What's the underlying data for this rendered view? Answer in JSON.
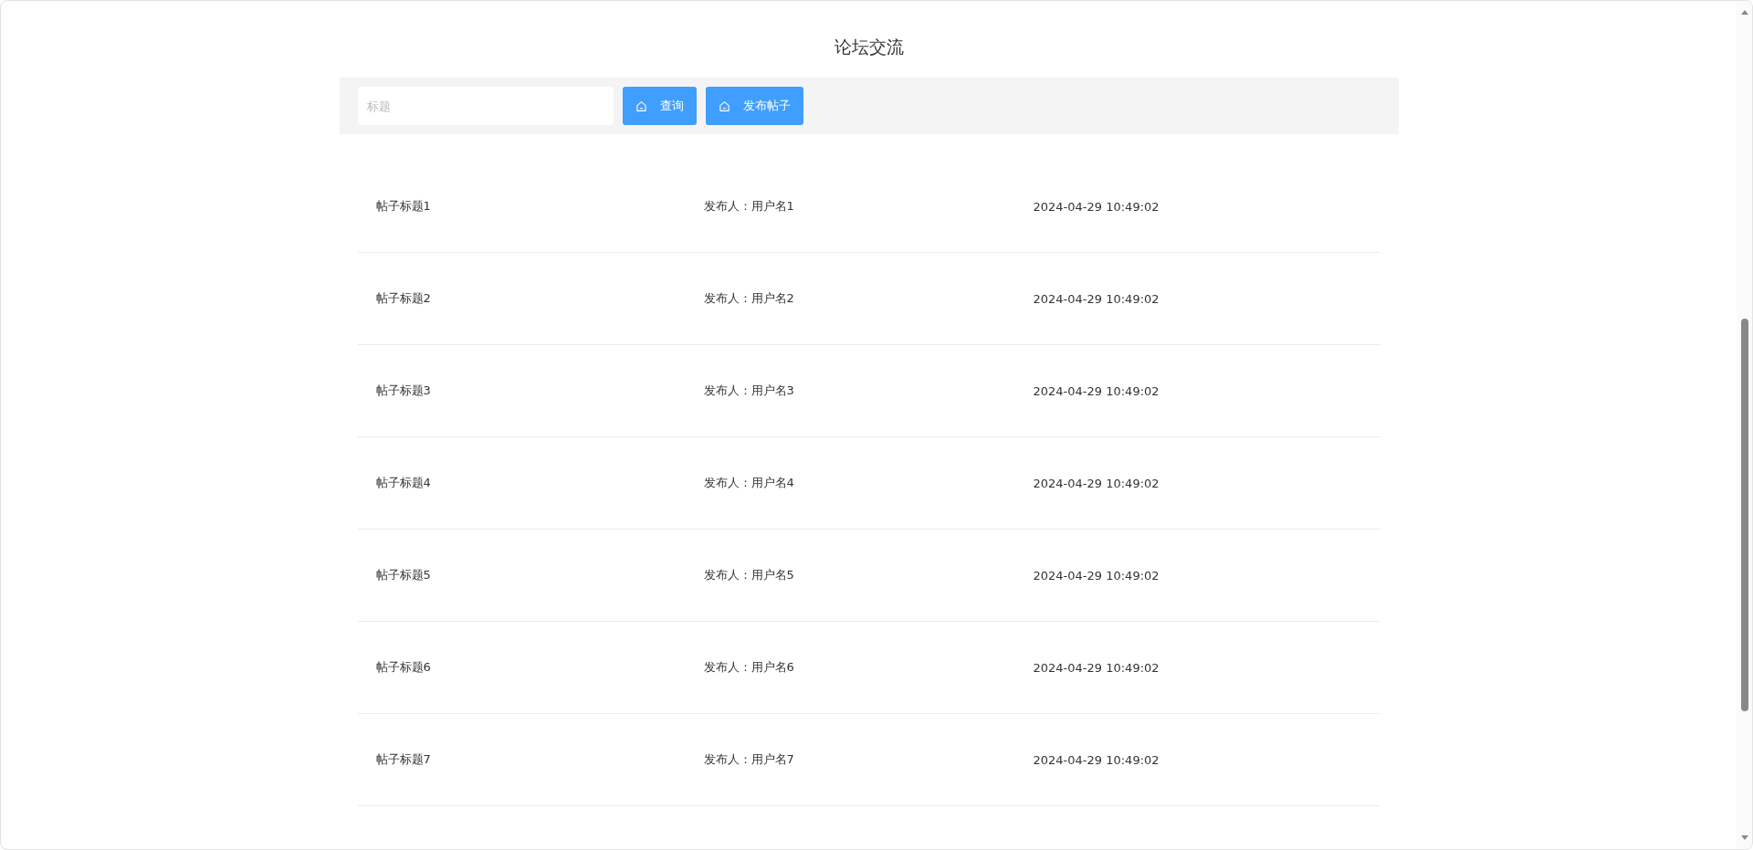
{
  "page_title": "论坛交流",
  "search": {
    "placeholder": "标题"
  },
  "buttons": [
    {
      "label": "查询"
    },
    {
      "label": "发布帖子"
    }
  ],
  "posts": [
    {
      "title": "帖子标题1",
      "author": "发布人：用户名1",
      "time": "2024-04-29 10:49:02"
    },
    {
      "title": "帖子标题2",
      "author": "发布人：用户名2",
      "time": "2024-04-29 10:49:02"
    },
    {
      "title": "帖子标题3",
      "author": "发布人：用户名3",
      "time": "2024-04-29 10:49:02"
    },
    {
      "title": "帖子标题4",
      "author": "发布人：用户名4",
      "time": "2024-04-29 10:49:02"
    },
    {
      "title": "帖子标题5",
      "author": "发布人：用户名5",
      "time": "2024-04-29 10:49:02"
    },
    {
      "title": "帖子标题6",
      "author": "发布人：用户名6",
      "time": "2024-04-29 10:49:02"
    },
    {
      "title": "帖子标题7",
      "author": "发布人：用户名7",
      "time": "2024-04-29 10:49:02"
    }
  ]
}
